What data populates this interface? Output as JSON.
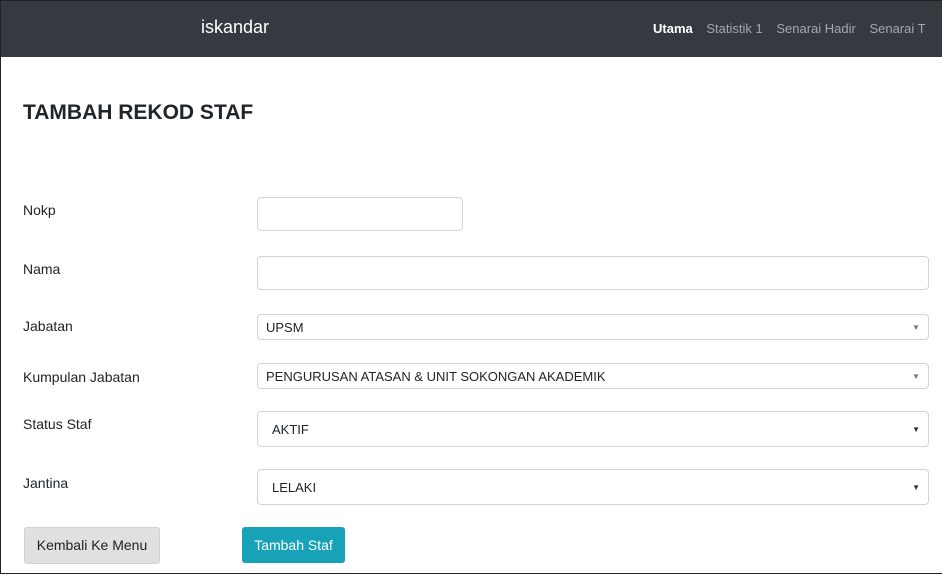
{
  "navbar": {
    "brand": "iskandar",
    "links": [
      "Utama",
      "Statistik 1",
      "Senarai Hadir",
      "Senarai T"
    ]
  },
  "page_title": "TAMBAH REKOD STAF",
  "form": {
    "nokp": {
      "label": "Nokp",
      "value": ""
    },
    "nama": {
      "label": "Nama",
      "value": ""
    },
    "jabatan": {
      "label": "Jabatan",
      "value": "UPSM"
    },
    "kumpulan_jabatan": {
      "label": "Kumpulan Jabatan",
      "value": "PENGURUSAN ATASAN & UNIT SOKONGAN AKADEMIK"
    },
    "status_staf": {
      "label": "Status Staf",
      "value": "AKTIF"
    },
    "jantina": {
      "label": "Jantina",
      "value": "LELAKI"
    }
  },
  "buttons": {
    "back": "Kembali Ke Menu",
    "add": "Tambah Staf"
  },
  "colors": {
    "navbar_bg": "#343a40",
    "primary_button": "#17a2b8",
    "secondary_button": "#e0e0e0"
  }
}
